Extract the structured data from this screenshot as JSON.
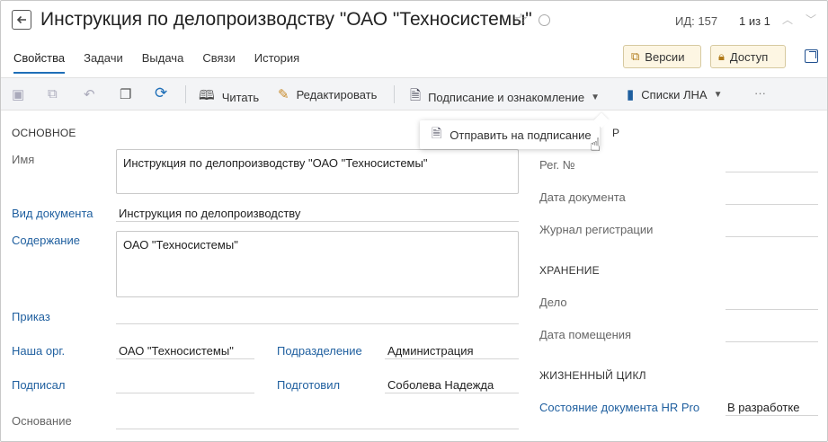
{
  "header": {
    "title": "Инструкция по делопроизводству \"ОАО \"Техносистемы\"",
    "id_label": "ИД: 157",
    "pager": "1 из 1"
  },
  "tabs": [
    "Свойства",
    "Задачи",
    "Выдача",
    "Связи",
    "История"
  ],
  "actions": {
    "versions": "Версии",
    "access": "Доступ"
  },
  "toolbar": {
    "read": "Читать",
    "edit": "Редактировать",
    "sign": "Подписание и ознакомление",
    "lna": "Списки ЛНА",
    "more": "···"
  },
  "dropdown": {
    "send_for_signing": "Отправить на подписание"
  },
  "form": {
    "basic_section": "ОСНОВНОЕ",
    "name_label": "Имя",
    "name_value": "Инструкция по делопроизводству \"ОАО \"Техносистемы\"",
    "doctype_label": "Вид документа",
    "doctype_value": "Инструкция по делопроизводству",
    "content_label": "Содержание",
    "content_value": "ОАО \"Техносистемы\"",
    "order_label": "Приказ",
    "org_label": "Наша орг.",
    "org_value": "ОАО \"Техносистемы\"",
    "dept_label": "Подразделение",
    "dept_value": "Администрация",
    "signed_label": "Подписал",
    "prepared_label": "Подготовил",
    "prepared_value": "Соболева Надежда",
    "basis_label": "Основание",
    "reg_section_tail": "Р",
    "reg_no_label": "Рег. №",
    "doc_date_label": "Дата документа",
    "journal_label": "Журнал регистрации",
    "storage_section": "ХРАНЕНИЕ",
    "case_label": "Дело",
    "placement_date_label": "Дата помещения",
    "lifecycle_section": "ЖИЗНЕННЫЙ ЦИКЛ",
    "state_label": "Состояние документа HR Pro",
    "state_value": "В разработке"
  }
}
